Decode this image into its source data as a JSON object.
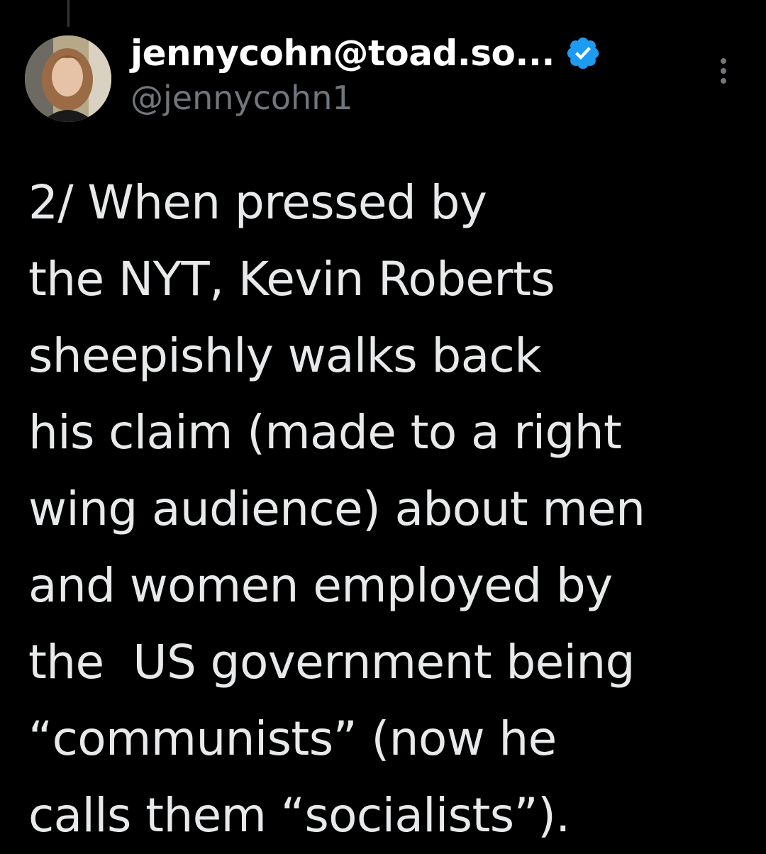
{
  "tweet": {
    "author": {
      "display_name": "jennycohn@toad.so...",
      "handle": "@jennycohn1",
      "verified": true,
      "verified_color": "#1d9bf0"
    },
    "more_icon": "more-vertical-icon",
    "text_lines": [
      "2/ When pressed by",
      "the NYT, Kevin Roberts",
      "sheepishly walks back",
      "his claim (made to a right",
      "wing audience) about men",
      "and women employed by",
      "the  US government being",
      "“communists” (now he",
      "calls them “socialists”)."
    ]
  },
  "colors": {
    "background": "#000000",
    "primary_text": "#e7e9ea",
    "secondary_text": "#71767b",
    "accent": "#1d9bf0"
  }
}
